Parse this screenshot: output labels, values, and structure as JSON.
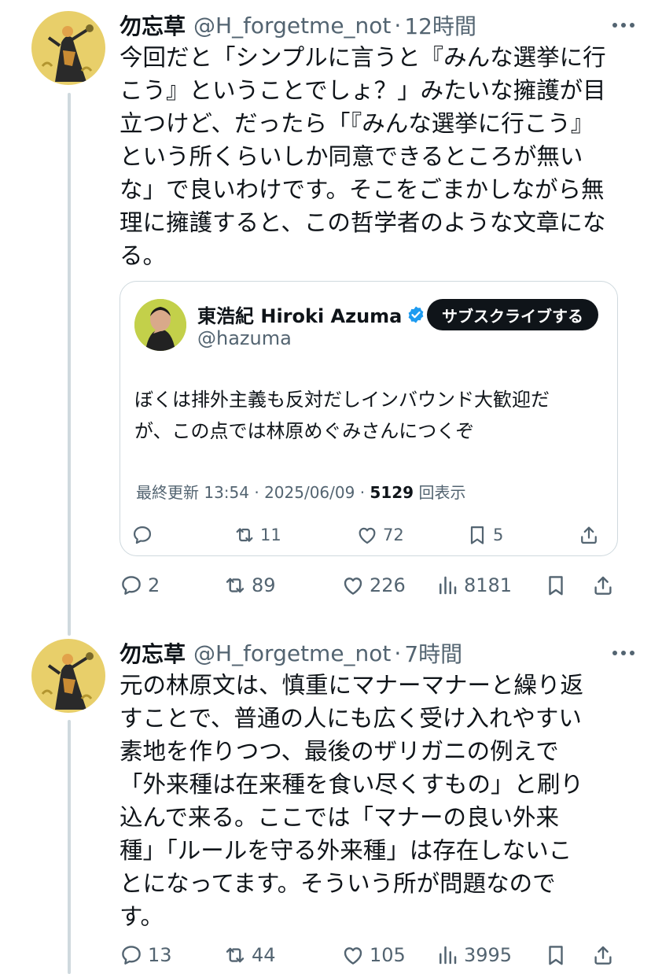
{
  "tweets": [
    {
      "name": "勿忘草",
      "handle": "@H_forgetme_not",
      "separator": "·",
      "time": "12時間",
      "text": "今回だと「シンプルに言うと『みんな選挙に行\nこう』ということでしょ？」みたいな擁護が目\n立つけど、だったら「『みんな選挙に行こう』\nという所くらいしか同意できるところが無い\nな」で良いわけです。そこをごまかしながら無\n理に擁護すると、この哲学者のような文章にな\nる。",
      "quote": {
        "name": "東浩紀 Hiroki Azuma",
        "handle": "@hazuma",
        "subscribe_label": "サブスクライブする",
        "text": "ぼくは排外主義も反対だしインバウンド大歓迎だ\nが、この点では林原めぐみさんにつくぞ",
        "meta_prefix": "最終更新 13:54 · 2025/06/09 · ",
        "views": "5129",
        "views_suffix": " 回表示",
        "replies": "",
        "retweets": "11",
        "likes": "72",
        "bookmarks": "5"
      },
      "replies": "2",
      "retweets": "89",
      "likes": "226",
      "views": "8181"
    },
    {
      "name": "勿忘草",
      "handle": "@H_forgetme_not",
      "separator": "·",
      "time": "7時間",
      "text": "元の林原文は、慎重にマナーマナーと繰り返\nすことで、普通の人にも広く受け入れやすい\n素地を作りつつ、最後のザリガニの例えで\n「外来種は在来種を食い尽くすもの」と刷り\n込んで来る。ここでは「マナーの良い外来\n種」「ルールを守る外来種」は存在しないこ\nとになってます。そういう所が問題なので\nす。",
      "replies": "13",
      "retweets": "44",
      "likes": "105",
      "views": "3995"
    }
  ],
  "colors": {
    "text": "#0f1419",
    "muted": "#536471",
    "border": "#cfd9de",
    "verified": "#1d9bf0"
  },
  "icons": [
    "reply-icon",
    "retweet-icon",
    "like-icon",
    "views-icon",
    "bookmark-icon",
    "share-icon",
    "more-icon",
    "verified-badge-icon"
  ]
}
